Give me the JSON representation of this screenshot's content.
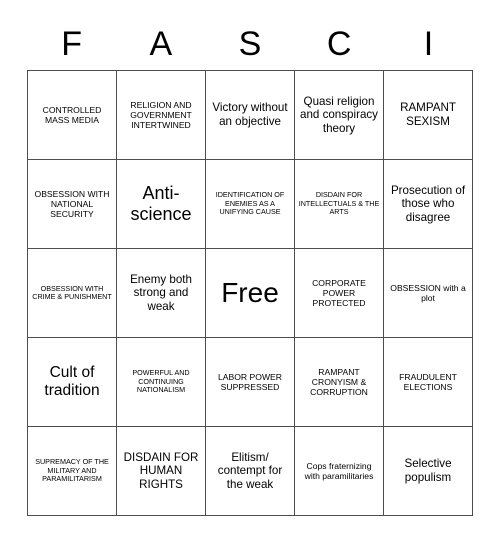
{
  "card": {
    "title_letters": [
      "F",
      "A",
      "S",
      "C",
      "I"
    ],
    "rows": [
      [
        {
          "text": "CONTROLLED MASS MEDIA",
          "size": "sm"
        },
        {
          "text": "RELIGION AND GOVERNMENT INTERTWINED",
          "size": "sm"
        },
        {
          "text": "Victory without an objective",
          "size": "md"
        },
        {
          "text": "Quasi religion and conspiracy theory",
          "size": "md"
        },
        {
          "text": "RAMPANT SEXISM",
          "size": "md"
        }
      ],
      [
        {
          "text": "OBSESSION WITH NATIONAL SECURITY",
          "size": "sm"
        },
        {
          "text": "Anti-science",
          "size": "xl"
        },
        {
          "text": "IDENTIFICATION OF ENEMIES AS A UNIFYING CAUSE",
          "size": "xs"
        },
        {
          "text": "DISDAIN FOR INTELLECTUALS & THE ARTS",
          "size": "xs"
        },
        {
          "text": "Prosecution of those who disagree",
          "size": "md"
        }
      ],
      [
        {
          "text": "OBSESSION WITH CRIME & PUNISHMENT",
          "size": "xs"
        },
        {
          "text": "Enemy both strong and weak",
          "size": "md"
        },
        {
          "text": "Free",
          "size": "free"
        },
        {
          "text": "CORPORATE POWER PROTECTED",
          "size": "sm"
        },
        {
          "text": "OBSESSION with a plot",
          "size": "sm"
        }
      ],
      [
        {
          "text": "Cult of tradition",
          "size": "lg"
        },
        {
          "text": "POWERFUL AND CONTINUING NATIONALISM",
          "size": "xs"
        },
        {
          "text": "LABOR POWER SUPPRESSED",
          "size": "sm"
        },
        {
          "text": "RAMPANT CRONYISM & CORRUPTION",
          "size": "sm"
        },
        {
          "text": "FRAUDULENT ELECTIONS",
          "size": "sm"
        }
      ],
      [
        {
          "text": "SUPREMACY OF THE MILITARY AND PARAMILITARISM",
          "size": "xs"
        },
        {
          "text": "DISDAIN FOR HUMAN RIGHTS",
          "size": "md"
        },
        {
          "text": "Elitism/ contempt for the weak",
          "size": "md"
        },
        {
          "text": "Cops fraternizing with paramilitaries",
          "size": "sm"
        },
        {
          "text": "Selective populism",
          "size": "md"
        }
      ]
    ]
  }
}
